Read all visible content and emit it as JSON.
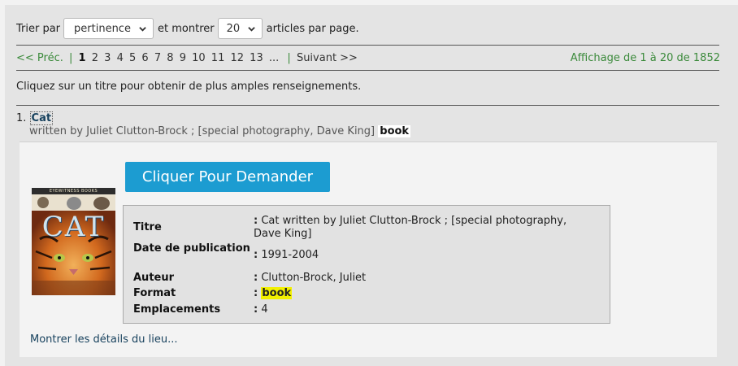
{
  "sort": {
    "prefix": "Trier par",
    "sort_value": "pertinence",
    "middle": "et montrer",
    "count_value": "20",
    "suffix": "articles par page."
  },
  "pager": {
    "prev": "<< Préc.",
    "separator": "|",
    "current": "1",
    "pages": [
      "2",
      "3",
      "4",
      "5",
      "6",
      "7",
      "8",
      "9",
      "10",
      "11",
      "12",
      "13"
    ],
    "ellipsis": "...",
    "next": "Suivant >>",
    "showing": "Affichage de 1 à 20 de 1852"
  },
  "hint": "Cliquez sur un titre pour obtenir de plus amples renseignements.",
  "result": {
    "index": "1.",
    "title": "Cat",
    "byline": "written by Juliet Clutton-Brock ; [special photography, Dave King]",
    "format_badge": "book",
    "request_button": "Cliquer Pour Demander",
    "cover": {
      "series": "EYEWITNESS BOOKS",
      "word": "CAT"
    },
    "details": {
      "title_label": "Titre",
      "title_value": "Cat written by Juliet Clutton-Brock ; [special photography, Dave King]",
      "date_label": "Date de publication",
      "date_value": "1991-2004",
      "author_label": "Auteur",
      "author_value": "Clutton-Brock, Juliet",
      "format_label": "Format",
      "format_value": "book",
      "locations_label": "Emplacements",
      "locations_value": "4",
      "colon": ":"
    },
    "more_link": "Montrer les détails du lieu..."
  },
  "colors": {
    "link_green": "#3b8a3b",
    "title_blue": "#18425e",
    "button_blue": "#1c9cd1",
    "highlight_yellow": "#f2f000"
  }
}
